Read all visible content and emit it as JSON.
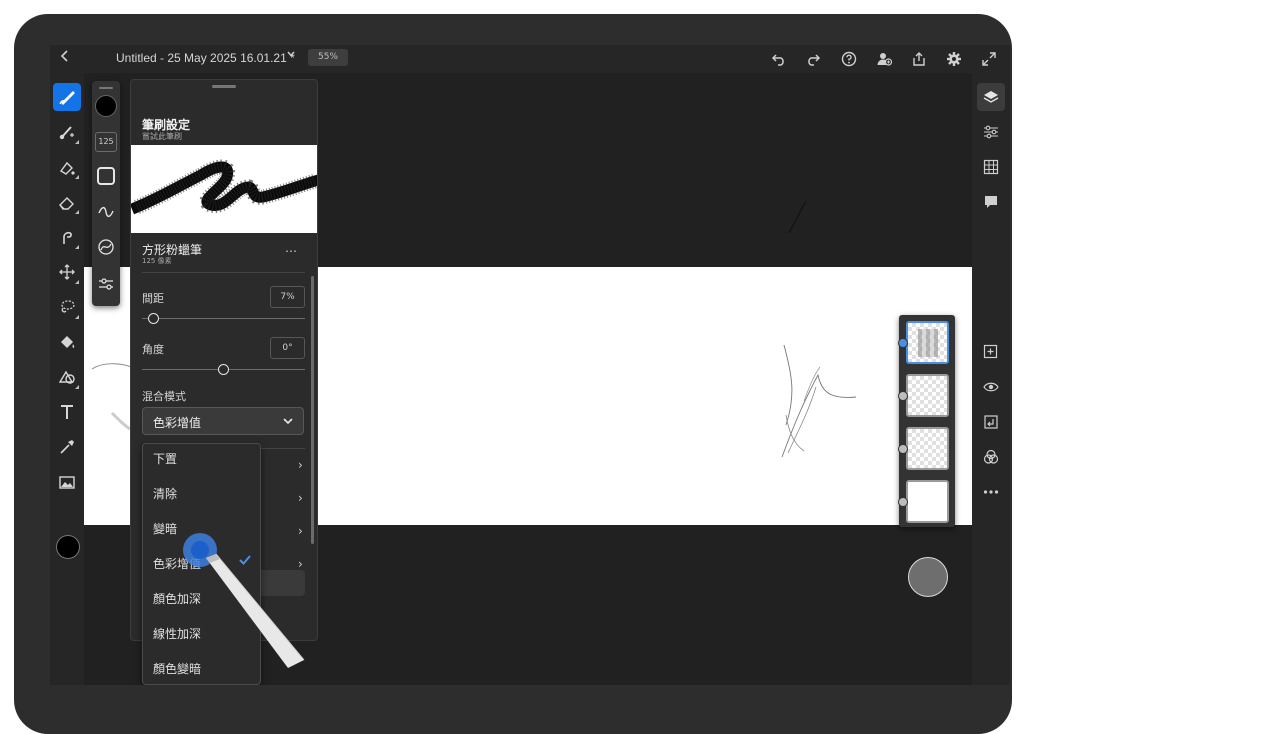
{
  "topbar": {
    "doc_title": "Untitled - 25 May 2025 16.01.21 *",
    "zoom": "55%",
    "icons": [
      "back-icon",
      "title-chevron-icon",
      "undo-icon",
      "redo-icon",
      "help-icon",
      "invite-icon",
      "share-icon",
      "settings-icon",
      "fullscreen-icon"
    ]
  },
  "left_tools": [
    "pixel-brush-icon",
    "live-brush-icon",
    "fill-brush-icon",
    "eraser-icon",
    "smudge-icon",
    "transform-icon",
    "lasso-icon",
    "paint-bucket-icon",
    "shape-icon",
    "type-icon",
    "eyedropper-icon",
    "image-icon"
  ],
  "current_color": "#000000",
  "brush_tools": {
    "size": "125"
  },
  "brush_panel": {
    "title": "筆刷設定",
    "subtitle": "嘗試此筆刷",
    "brush_name": "方形粉蠟筆",
    "brush_size": "125 像素",
    "more": "…",
    "spacing_label": "間距",
    "spacing_value": "7%",
    "spacing_level": 0.07,
    "angle_label": "角度",
    "angle_value": "0°",
    "angle_level": 0.5,
    "blend_label": "混合模式",
    "blend_selected": "色彩增值"
  },
  "blend_options": [
    "下置",
    "清除",
    "變暗",
    "色彩增值",
    "顏色加深",
    "線性加深",
    "顏色變暗"
  ],
  "right_tools": [
    "layers-icon",
    "adjust-icon",
    "grid-icon",
    "comment-icon",
    "add-layer-icon",
    "visibility-icon",
    "import-icon",
    "blend-icon",
    "more-icon"
  ],
  "colors": {
    "accent": "#1473e6",
    "selection": "#4a90e2",
    "panel": "#2b2b2b",
    "chrome": "#262626"
  }
}
